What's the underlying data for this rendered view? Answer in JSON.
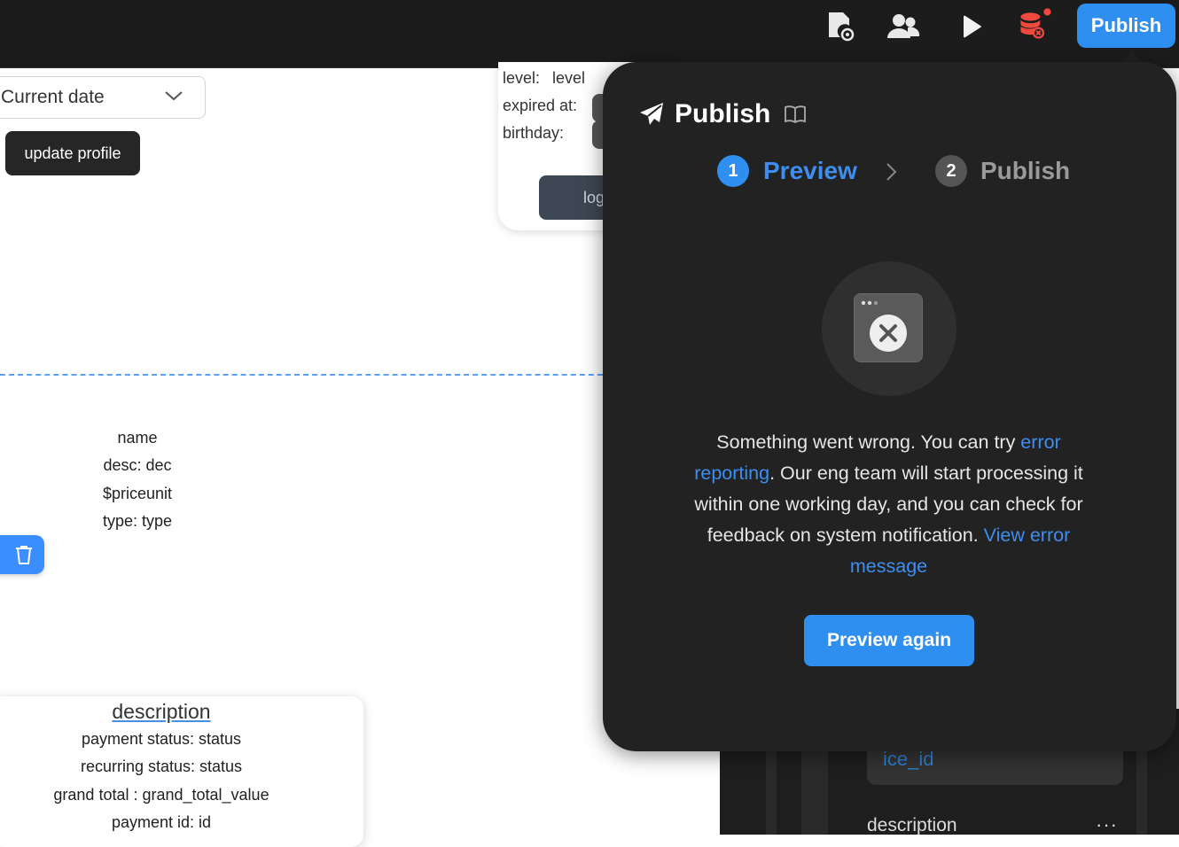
{
  "topbar": {
    "icons": [
      "file-settings-icon",
      "users-icon",
      "play-icon",
      "database-error-icon"
    ],
    "publish_label": "Publish",
    "accent": "#2f8ff0",
    "notification_color": "#f04a3f"
  },
  "canvas": {
    "date_select": {
      "value": "Current date"
    },
    "update_button": "update profile",
    "profile_card": {
      "level_label": "level:",
      "level_value": "level",
      "expired_label": "expired at:",
      "birthday_label": "birthday:",
      "log_button": "log"
    },
    "product": {
      "name": "name",
      "desc": "desc: dec",
      "price": "$priceunit",
      "type": "type: type"
    },
    "description_card": {
      "title": "description",
      "lines": [
        "payment status: status",
        "recurring status: status",
        "grand total : grand_total_value",
        "payment id: id"
      ]
    }
  },
  "right_panel": {
    "field_value": "ice_id",
    "description_label": "description",
    "more": "···"
  },
  "publish_popover": {
    "title": "Publish",
    "steps": [
      {
        "number": "1",
        "label": "Preview",
        "active": true
      },
      {
        "number": "2",
        "label": "Publish",
        "active": false
      }
    ],
    "message": {
      "part1": "Something went wrong. You can try ",
      "link1": "error reporting",
      "part2": ". Our eng team will start processing it within one working day, and you can check for feedback on system notification. ",
      "link2": "View error message"
    },
    "action_button": "Preview again",
    "link_color": "#3d8ef0"
  }
}
